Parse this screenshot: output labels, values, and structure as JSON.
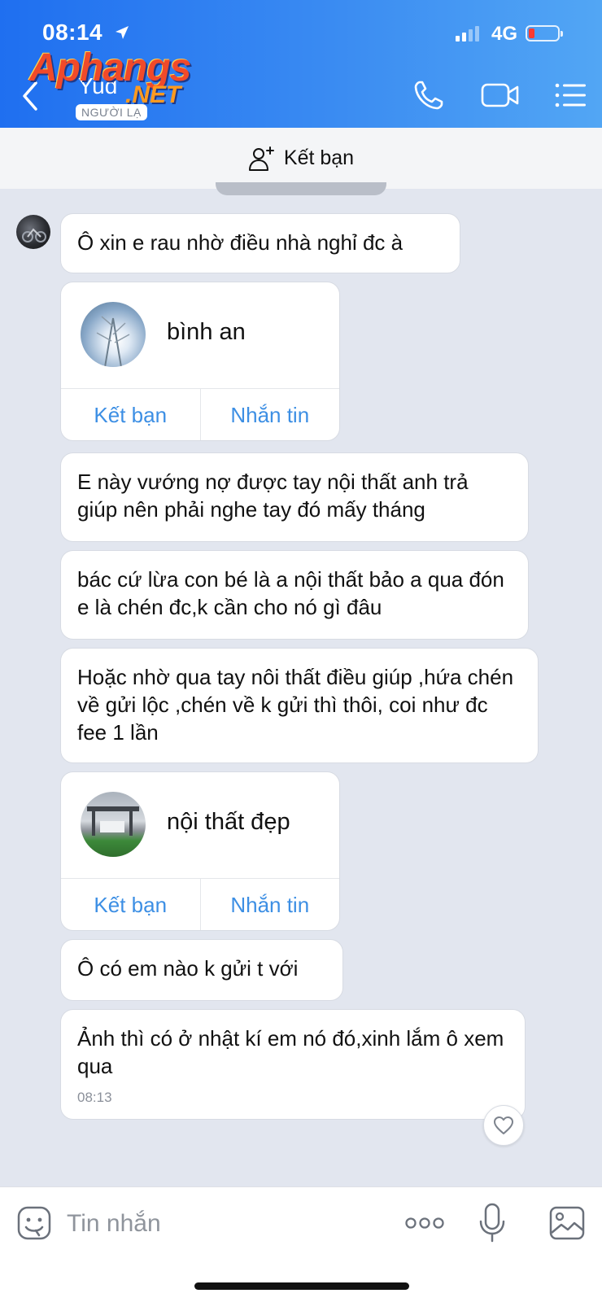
{
  "status_bar": {
    "time": "08:14",
    "network": "4G"
  },
  "header": {
    "contact_name": "Yud",
    "stranger_label": "NGƯỜI LẠ",
    "watermark_main": "Aphangs",
    "watermark_sub": ".NET",
    "background_colors": [
      "#1f6ff0",
      "#52a6f4"
    ],
    "icons": [
      "back-icon",
      "phone-icon",
      "video-call-icon",
      "menu-list-icon"
    ]
  },
  "friend_bar": {
    "label": "Kết bạn",
    "icon": "add-friend-icon"
  },
  "messages": [
    {
      "type": "text",
      "text": "Ô xin e rau nhờ điều nhà nghỉ đc à"
    },
    {
      "type": "contact_card",
      "name": "bình an",
      "add_label": "Kết bạn",
      "msg_label": "Nhắn tin"
    },
    {
      "type": "text",
      "text": "E này vướng nợ được tay nội thất anh trả giúp nên phải nghe tay đó mấy tháng"
    },
    {
      "type": "text",
      "text": "bác cứ lừa con bé là a nội thất bảo a qua đón e là chén đc,k cần cho nó gì đâu"
    },
    {
      "type": "text",
      "text": "Hoặc nhờ qua tay nôi thất điều giúp ,hứa chén về gửi lộc ,chén về k gửi thì thôi, coi như đc fee 1 lần"
    },
    {
      "type": "contact_card",
      "name": "nội thất đẹp",
      "add_label": "Kết bạn",
      "msg_label": "Nhắn tin"
    },
    {
      "type": "text",
      "text": "Ô có em nào k gửi t với"
    },
    {
      "type": "text",
      "text": "Ảnh thì có ở nhật kí em nó đó,xinh lắm ô xem qua",
      "time": "08:13"
    }
  ],
  "input_bar": {
    "placeholder": "Tin nhắn",
    "icons": [
      "sticker-icon",
      "more-icon",
      "microphone-icon",
      "image-icon"
    ]
  },
  "colors": {
    "accent": "#3d8fe4",
    "chat_bg": "#e2e6ef",
    "bubble": "#ffffff"
  }
}
